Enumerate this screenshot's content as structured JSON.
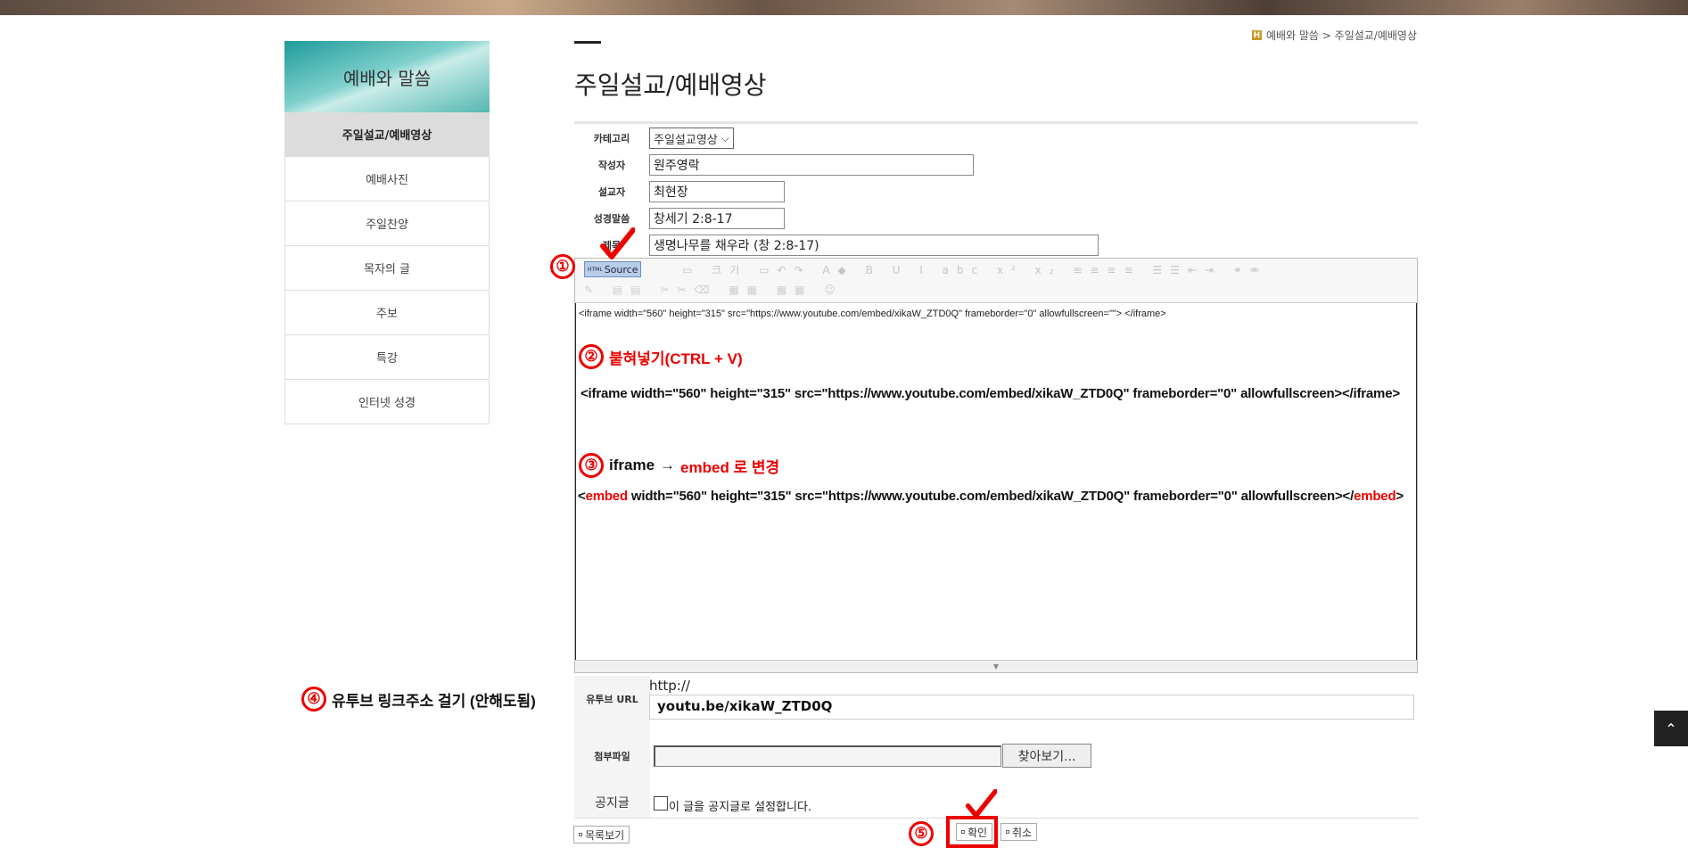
{
  "breadcrumb": {
    "icon_letter": "H",
    "path": "예배와 말씀 > 주일설교/예배영상"
  },
  "page_title": "주일설교/예배영상",
  "sidebar": {
    "heading": "예배와 말씀",
    "items": [
      {
        "label": "주일설교/예배영상",
        "active": true
      },
      {
        "label": "예배사진"
      },
      {
        "label": "주일찬양"
      },
      {
        "label": "목자의 글"
      },
      {
        "label": "주보"
      },
      {
        "label": "특강"
      },
      {
        "label": "인터넷 성경"
      }
    ]
  },
  "form": {
    "category": {
      "label": "카테고리",
      "value": "주일설교영상"
    },
    "author": {
      "label": "작성자",
      "value": "원주영락"
    },
    "preacher": {
      "label": "설교자",
      "value": "최현장"
    },
    "scripture": {
      "label": "성경말씀",
      "value": "창세기 2:8-17"
    },
    "subject": {
      "label": "제목",
      "value": "생명나무를 채우라 (창 2:8-17)"
    }
  },
  "editor": {
    "source_button": "Source",
    "source_prefix": "HTML",
    "font_size_label": "크기",
    "code_line": "<iframe width=\"560\" height=\"315\" src=\"https://www.youtube.com/embed/xikaW_ZTD0Q\" frameborder=\"0\" allowfullscreen=\"\"> </iframe>"
  },
  "annotations": {
    "step1": "①",
    "step2": {
      "num": "②",
      "text": "붙혀넣기(CTRL + V)"
    },
    "step2_code": "<iframe width=\"560\" height=\"315\" src=\"https://www.youtube.com/embed/xikaW_ZTD0Q\" frameborder=\"0\" allowfullscreen></iframe>",
    "step3": {
      "num": "③",
      "text_a": "iframe",
      "arrow": "→",
      "text_b": "embed 로 변경"
    },
    "step3_code": {
      "open": "<",
      "tag": "embed",
      "mid": " width=\"560\" height=\"315\" src=\"https://www.youtube.com/embed/xikaW_ZTD0Q\" frameborder=\"0\" allowfullscreen></",
      "close": ">"
    },
    "step4": {
      "num": "④",
      "text": "유투브 링크주소 걸기 (안해도됨)"
    },
    "step5": "⑤"
  },
  "youtube": {
    "label": "유투브 URL",
    "prefix": "http://",
    "value": "youtu.be/xikaW_ZTD0Q"
  },
  "attach": {
    "label": "첨부파일",
    "browse": "찾아보기..."
  },
  "notice": {
    "label": "공지글",
    "text": "이 글을 공지글로 설정합니다."
  },
  "buttons": {
    "list": "목록보기",
    "ok": "확인",
    "cancel": "취소"
  },
  "colors": {
    "annotation": "#e00000",
    "sidebar_teal": "#1e9b9b"
  }
}
